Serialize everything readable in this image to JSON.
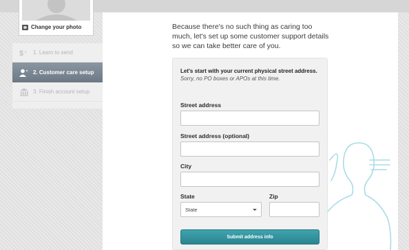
{
  "profile": {
    "change_photo_label": "Change your photo"
  },
  "steps": [
    {
      "label": "1. Learn to send",
      "icon": "dollar-plus-icon",
      "state": "done"
    },
    {
      "label": "2. Customer care setup",
      "icon": "user-icon",
      "state": "active"
    },
    {
      "label": "3. Finish account setup",
      "icon": "bank-icon",
      "state": "upcoming"
    }
  ],
  "main": {
    "intro": "Because there's no such thing as caring too much, let's set up some customer support details so we can take better care of you."
  },
  "form": {
    "intro_bold": "Let's start with your current physical street address.",
    "intro_italic": "Sorry, no PO boxes or APOs at this time.",
    "street_label": "Street address",
    "street_value": "",
    "street2_label": "Street address (optional)",
    "street2_value": "",
    "city_label": "City",
    "city_value": "",
    "state_label": "State",
    "state_selected": "State",
    "zip_label": "Zip",
    "zip_value": "",
    "submit_label": "Submit address info"
  },
  "colors": {
    "accent": "#2f8f99",
    "active_step": "#7a8691",
    "decoration": "#a9dbe6"
  }
}
